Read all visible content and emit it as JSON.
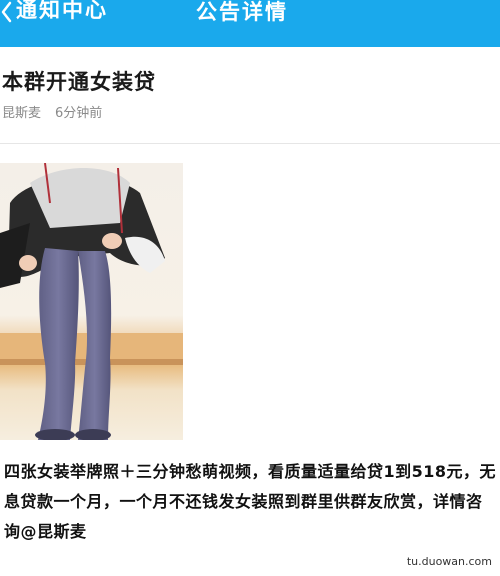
{
  "topbar": {
    "back_label": "通知中心",
    "title": "公告详情"
  },
  "notice": {
    "title": "本群开通女装贷",
    "author": "昆斯麦",
    "time": "6分钟前",
    "body": "四张女装举牌照＋三分钟愁萌视频，看质量适量给贷1到518元，无息贷款一个月，一个月不还钱发女装照到群里供群友欣赏，详情咨询@昆斯麦"
  },
  "watermark": "tu.duowan.com",
  "colors": {
    "topbar": "#1aa9ec"
  }
}
